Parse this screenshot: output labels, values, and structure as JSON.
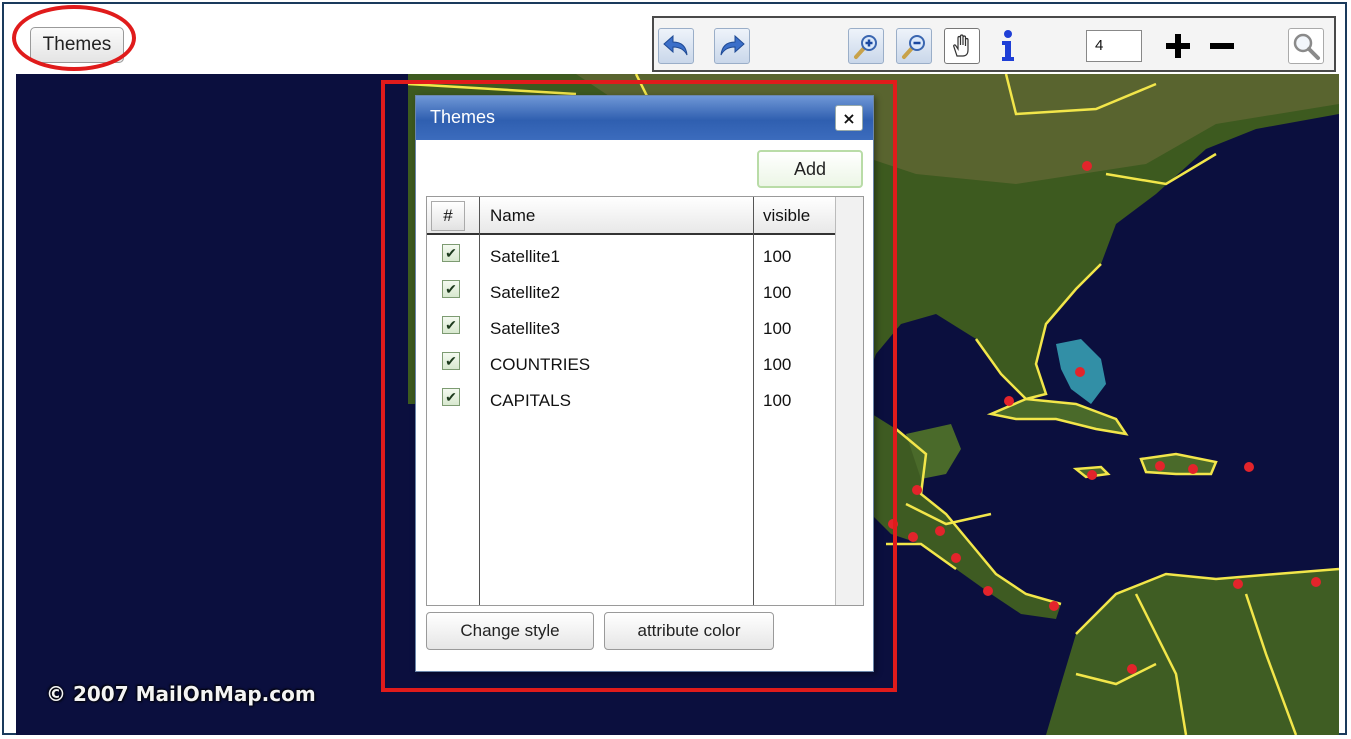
{
  "topbar": {
    "themes_button_label": "Themes"
  },
  "toolbar": {
    "buttons": [
      {
        "icon": "undo-arrow-icon"
      },
      {
        "icon": "redo-arrow-icon"
      },
      {
        "icon": "zoom-in-icon"
      },
      {
        "icon": "zoom-out-icon"
      },
      {
        "icon": "pan-hand-icon"
      },
      {
        "icon": "info-icon"
      },
      {
        "icon": "plus-icon"
      },
      {
        "icon": "minus-icon"
      },
      {
        "icon": "search-icon"
      }
    ],
    "zoom_level": "4"
  },
  "map": {
    "copyright": "© 2007 MailOnMap.com"
  },
  "dialog": {
    "title": "Themes",
    "close_label": "×",
    "add_label": "Add",
    "columns": {
      "hash": "#",
      "name": "Name",
      "visible": "visible"
    },
    "rows": [
      {
        "checked": true,
        "name": "Satellite1",
        "visible": "100"
      },
      {
        "checked": true,
        "name": "Satellite2",
        "visible": "100"
      },
      {
        "checked": true,
        "name": "Satellite3",
        "visible": "100"
      },
      {
        "checked": true,
        "name": "COUNTRIES",
        "visible": "100"
      },
      {
        "checked": true,
        "name": "CAPITALS",
        "visible": "100"
      }
    ],
    "change_style_label": "Change style",
    "attribute_color_label": "attribute color"
  },
  "colors": {
    "highlight": "#e01b1b",
    "map_ocean": "#0b0f3e",
    "title_bar": "#2f5fb0",
    "borders": "#f2e64a",
    "capitals": "#e3242b"
  }
}
